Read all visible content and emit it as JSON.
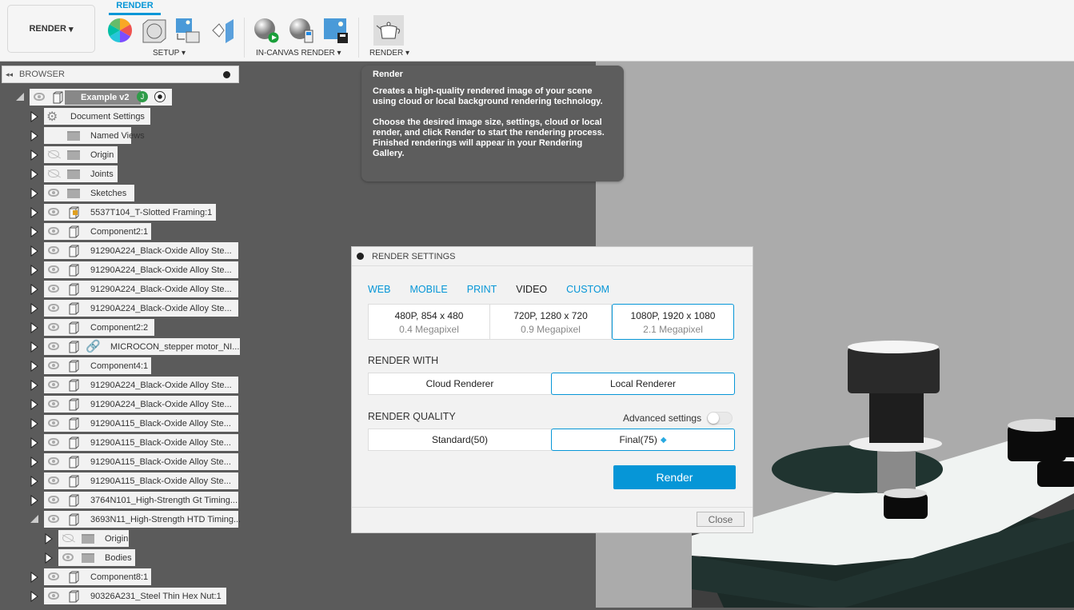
{
  "toolbar": {
    "workspace": "RENDER",
    "tab": "RENDER",
    "groups": {
      "setup": "SETUP ▾",
      "in_canvas": "IN-CANVAS RENDER ▾",
      "render": "RENDER ▾"
    }
  },
  "browser": {
    "title": "BROWSER",
    "rows": [
      {
        "label": "Example v2",
        "icon": "component-root",
        "eye": "visible",
        "expanded": true,
        "level": 0
      },
      {
        "label": "Document Settings",
        "icon": "gear",
        "eye": "none",
        "level": 1
      },
      {
        "label": "Named Views",
        "icon": "folder",
        "eye": "none",
        "level": 1
      },
      {
        "label": "Origin",
        "icon": "folder",
        "eye": "hidden",
        "level": 1
      },
      {
        "label": "Joints",
        "icon": "folder",
        "eye": "hidden",
        "level": 1
      },
      {
        "label": "Sketches",
        "icon": "folder",
        "eye": "visible",
        "level": 1
      },
      {
        "label": "5537T104_T-Slotted Framing:1",
        "icon": "component-ref",
        "eye": "visible",
        "level": 1
      },
      {
        "label": "Component2:1",
        "icon": "component",
        "eye": "visible",
        "level": 1
      },
      {
        "label": "91290A224_Black-Oxide Alloy Ste...",
        "icon": "component",
        "eye": "visible",
        "level": 1
      },
      {
        "label": "91290A224_Black-Oxide Alloy Ste...",
        "icon": "component",
        "eye": "visible",
        "level": 1
      },
      {
        "label": "91290A224_Black-Oxide Alloy Ste...",
        "icon": "component",
        "eye": "visible",
        "level": 1
      },
      {
        "label": "91290A224_Black-Oxide Alloy Ste...",
        "icon": "component",
        "eye": "visible",
        "level": 1
      },
      {
        "label": "Component2:2",
        "icon": "component",
        "eye": "visible",
        "level": 1
      },
      {
        "label": "MICROCON_stepper motor_NI...",
        "icon": "component-link",
        "eye": "visible",
        "level": 1
      },
      {
        "label": "Component4:1",
        "icon": "component",
        "eye": "visible",
        "level": 1
      },
      {
        "label": "91290A224_Black-Oxide Alloy Ste...",
        "icon": "component",
        "eye": "visible",
        "level": 1
      },
      {
        "label": "91290A224_Black-Oxide Alloy Ste...",
        "icon": "component",
        "eye": "visible",
        "level": 1
      },
      {
        "label": "91290A115_Black-Oxide Alloy Ste...",
        "icon": "component",
        "eye": "visible",
        "level": 1
      },
      {
        "label": "91290A115_Black-Oxide Alloy Ste...",
        "icon": "component",
        "eye": "visible",
        "level": 1
      },
      {
        "label": "91290A115_Black-Oxide Alloy Ste...",
        "icon": "component",
        "eye": "visible",
        "level": 1
      },
      {
        "label": "91290A115_Black-Oxide Alloy Ste...",
        "icon": "component",
        "eye": "visible",
        "level": 1
      },
      {
        "label": "3764N101_High-Strength Gt Timing...",
        "icon": "component",
        "eye": "visible",
        "level": 1
      },
      {
        "label": "3693N11_High-Strength HTD Timing...",
        "icon": "component",
        "eye": "visible",
        "expanded": true,
        "level": 1
      },
      {
        "label": "Origin",
        "icon": "folder",
        "eye": "hidden",
        "level": 2
      },
      {
        "label": "Bodies",
        "icon": "folder",
        "eye": "visible",
        "level": 2
      },
      {
        "label": "Component8:1",
        "icon": "component",
        "eye": "visible",
        "level": 1
      },
      {
        "label": "90326A231_Steel Thin Hex Nut:1",
        "icon": "component",
        "eye": "visible",
        "level": 1
      }
    ]
  },
  "tooltip": {
    "title": "Render",
    "p1": "Creates a high-quality rendered image of your scene using cloud or local background rendering technology.",
    "p2": "Choose the desired image size, settings, cloud or local render, and click Render to start the rendering process. Finished renderings will appear in your Rendering Gallery."
  },
  "dialog": {
    "title": "RENDER SETTINGS",
    "tabs": [
      "WEB",
      "MOBILE",
      "PRINT",
      "VIDEO",
      "CUSTOM"
    ],
    "active_tab": "VIDEO",
    "resolutions": [
      {
        "name": "480P, 854 x 480",
        "mp": "0.4 Megapixel"
      },
      {
        "name": "720P, 1280 x 720",
        "mp": "0.9 Megapixel"
      },
      {
        "name": "1080P, 1920 x 1080",
        "mp": "2.1 Megapixel",
        "selected": true
      }
    ],
    "render_with_label": "RENDER WITH",
    "renderers": [
      "Cloud Renderer",
      "Local Renderer"
    ],
    "selected_renderer": "Local Renderer",
    "quality_label": "RENDER QUALITY",
    "advanced_label": "Advanced settings",
    "advanced_on": false,
    "qualities": [
      "Standard(50)",
      "Final(75)"
    ],
    "selected_quality": "Final(75)",
    "render_button": "Render",
    "close_button": "Close"
  },
  "colors": {
    "accent": "#0696d7"
  }
}
